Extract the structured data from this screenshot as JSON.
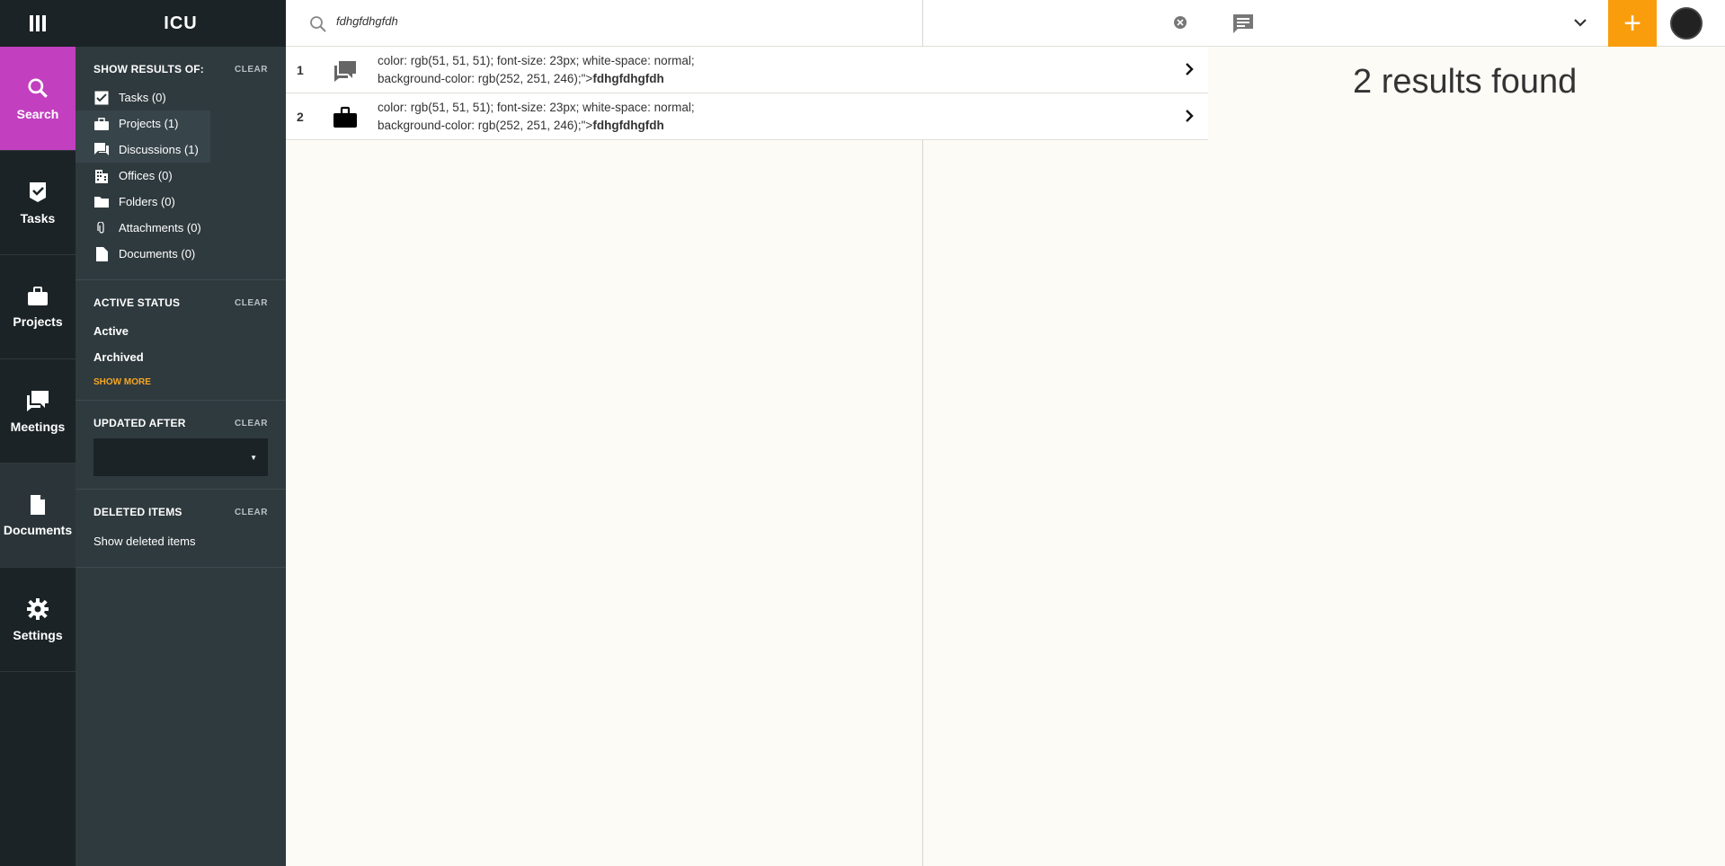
{
  "app": {
    "brand": "ICU"
  },
  "rail": {
    "items": [
      {
        "label": "Search",
        "icon": "search-icon"
      },
      {
        "label": "Tasks",
        "icon": "task-check-icon"
      },
      {
        "label": "Projects",
        "icon": "briefcase-icon"
      },
      {
        "label": "Meetings",
        "icon": "forum-icon"
      },
      {
        "label": "Documents",
        "icon": "document-icon"
      },
      {
        "label": "Settings",
        "icon": "gear-icon"
      }
    ]
  },
  "filters": {
    "show_results": {
      "title": "SHOW RESULTS OF:",
      "clear": "CLEAR",
      "items": [
        {
          "label": "Tasks (0)",
          "icon": "checkbox-checked-icon"
        },
        {
          "label": "Projects (1)",
          "icon": "briefcase-icon"
        },
        {
          "label": "Discussions (1)",
          "icon": "forum-icon"
        },
        {
          "label": "Offices (0)",
          "icon": "building-icon"
        },
        {
          "label": "Folders (0)",
          "icon": "folder-icon"
        },
        {
          "label": "Attachments (0)",
          "icon": "paperclip-icon"
        },
        {
          "label": "Documents (0)",
          "icon": "document-icon"
        }
      ]
    },
    "active_status": {
      "title": "ACTIVE STATUS",
      "clear": "CLEAR",
      "items": [
        "Active",
        "Archived"
      ],
      "show_more": "SHOW MORE"
    },
    "updated_after": {
      "title": "UPDATED AFTER",
      "clear": "CLEAR"
    },
    "deleted_items": {
      "title": "DELETED ITEMS",
      "clear": "CLEAR",
      "option": "Show deleted items"
    }
  },
  "search": {
    "value": "fdhgfdhgfdh"
  },
  "results": [
    {
      "num": "1",
      "icon": "forum-icon",
      "line1": "color: rgb(51, 51, 51); font-size: 23px; white-space: normal;",
      "line2_prefix": "background-color: rgb(252, 251, 246);\">",
      "match": "fdhgfdhgfdh"
    },
    {
      "num": "2",
      "icon": "briefcase-icon",
      "line1": "color: rgb(51, 51, 51); font-size: 23px; white-space: normal;",
      "line2_prefix": "background-color: rgb(252, 251, 246);\">",
      "match": "fdhgfdhgfdh"
    }
  ],
  "summary": {
    "count_text": "2 results found"
  },
  "colors": {
    "accent_search": "#c23fbf",
    "add_button": "#fa9d0c",
    "rail_bg": "#1b2326",
    "sidebar_bg": "#2f3a3e"
  }
}
